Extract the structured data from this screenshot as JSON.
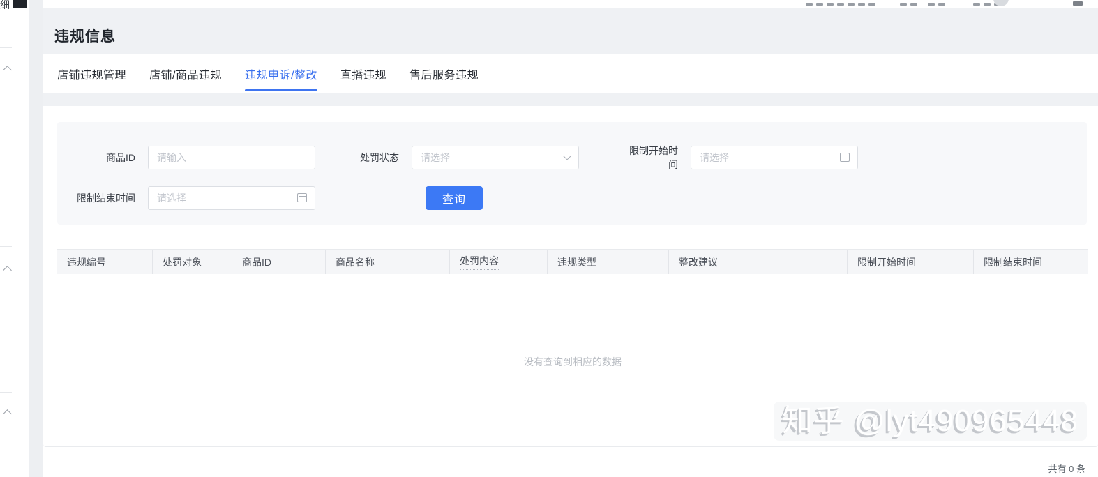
{
  "page": {
    "title": "违规信息"
  },
  "sidebar": {
    "clipped_char": "细"
  },
  "tabs": [
    {
      "label": "店铺违规管理",
      "active": false
    },
    {
      "label": "店铺/商品违规",
      "active": false
    },
    {
      "label": "违规申诉/整改",
      "active": true
    },
    {
      "label": "直播违规",
      "active": false
    },
    {
      "label": "售后服务违规",
      "active": false
    }
  ],
  "filter": {
    "fields": [
      {
        "label": "商品ID",
        "placeholder": "请输入",
        "type": "input"
      },
      {
        "label": "处罚状态",
        "placeholder": "请选择",
        "type": "select"
      },
      {
        "label": "限制开始时间",
        "placeholder": "请选择",
        "type": "date"
      },
      {
        "label": "限制结束时间",
        "placeholder": "请选择",
        "type": "date"
      }
    ],
    "search_label": "查询"
  },
  "table": {
    "columns": [
      "违规编号",
      "处罚对象",
      "商品ID",
      "商品名称",
      "处罚内容",
      "违规类型",
      "整改建议",
      "限制开始时间",
      "限制结束时间"
    ],
    "empty_text": "没有查询到相应的数据"
  },
  "footer": {
    "total_text": "共有 0 条"
  },
  "watermark": "知乎 @lyt490965448",
  "colors": {
    "accent_blue": "#3c79f5",
    "tab_active": "#3a70ee",
    "band_gray": "#eff1f4"
  }
}
